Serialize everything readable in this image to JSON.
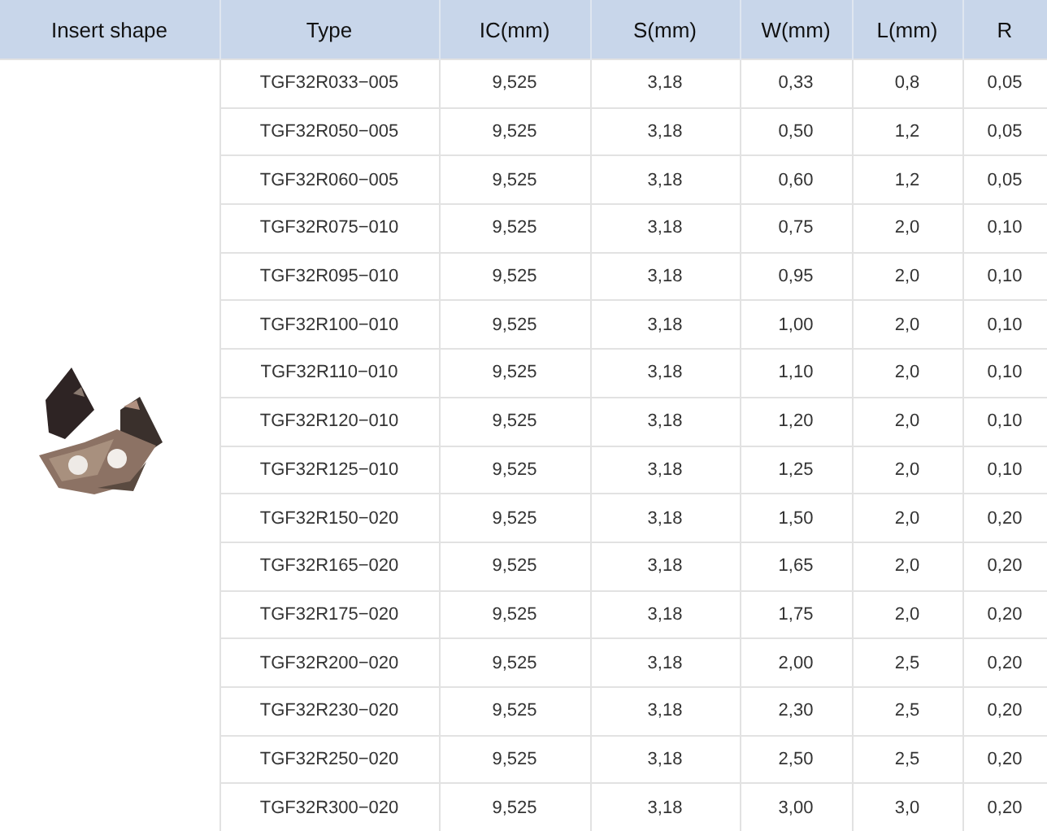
{
  "columns": [
    "Insert shape",
    "Type",
    "IC(mm)",
    "S(mm)",
    "W(mm)",
    "L(mm)",
    "R"
  ],
  "insert_shape": {
    "kind": "picture"
  },
  "rows": [
    [
      "TGF32R033−005",
      "9,525",
      "3,18",
      "0,33",
      "0,8",
      "0,05"
    ],
    [
      "TGF32R050−005",
      "9,525",
      "3,18",
      "0,50",
      "1,2",
      "0,05"
    ],
    [
      "TGF32R060−005",
      "9,525",
      "3,18",
      "0,60",
      "1,2",
      "0,05"
    ],
    [
      "TGF32R075−010",
      "9,525",
      "3,18",
      "0,75",
      "2,0",
      "0,10"
    ],
    [
      "TGF32R095−010",
      "9,525",
      "3,18",
      "0,95",
      "2,0",
      "0,10"
    ],
    [
      "TGF32R100−010",
      "9,525",
      "3,18",
      "1,00",
      "2,0",
      "0,10"
    ],
    [
      "TGF32R110−010",
      "9,525",
      "3,18",
      "1,10",
      "2,0",
      "0,10"
    ],
    [
      "TGF32R120−010",
      "9,525",
      "3,18",
      "1,20",
      "2,0",
      "0,10"
    ],
    [
      "TGF32R125−010",
      "9,525",
      "3,18",
      "1,25",
      "2,0",
      "0,10"
    ],
    [
      "TGF32R150−020",
      "9,525",
      "3,18",
      "1,50",
      "2,0",
      "0,20"
    ],
    [
      "TGF32R165−020",
      "9,525",
      "3,18",
      "1,65",
      "2,0",
      "0,20"
    ],
    [
      "TGF32R175−020",
      "9,525",
      "3,18",
      "1,75",
      "2,0",
      "0,20"
    ],
    [
      "TGF32R200−020",
      "9,525",
      "3,18",
      "2,00",
      "2,5",
      "0,20"
    ],
    [
      "TGF32R230−020",
      "9,525",
      "3,18",
      "2,30",
      "2,5",
      "0,20"
    ],
    [
      "TGF32R250−020",
      "9,525",
      "3,18",
      "2,50",
      "2,5",
      "0,20"
    ],
    [
      "TGF32R300−020",
      "9,525",
      "3,18",
      "3,00",
      "3,0",
      "0,20"
    ]
  ]
}
